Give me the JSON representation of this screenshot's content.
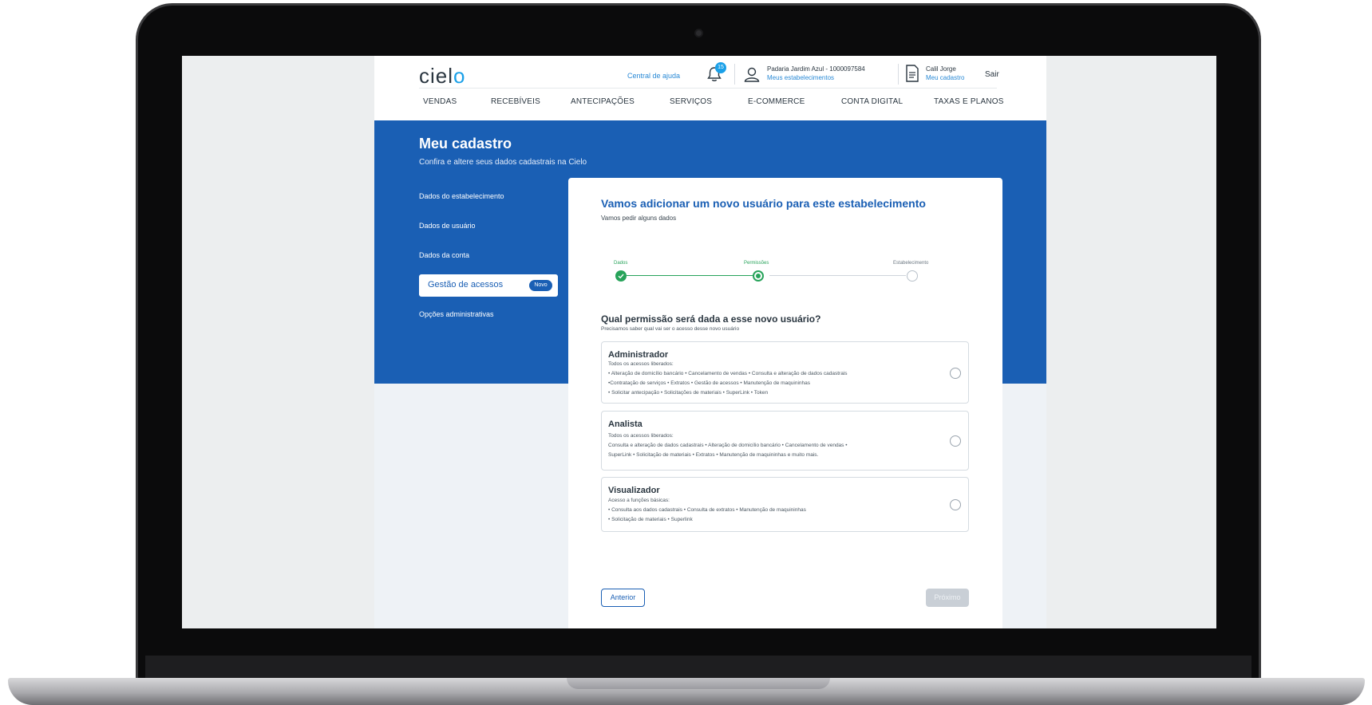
{
  "header": {
    "logo": "cielo",
    "help_link": "Central de ajuda",
    "notification_count": "15",
    "establishment_name": "Padaria Jardim Azul - 1000097584",
    "establishments_link": "Meus estabelecimentos",
    "user_name": "Calil Jorge",
    "profile_link": "Meu cadastro",
    "logout": "Sair"
  },
  "nav": [
    "VENDAS",
    "RECEBÍVEIS",
    "ANTECIPAÇÕES",
    "SERVIÇOS",
    "E-COMMERCE",
    "CONTA DIGITAL",
    "TAXAS E PLANOS"
  ],
  "hero": {
    "title": "Meu cadastro",
    "subtitle": "Confira e altere seus dados cadastrais na Cielo"
  },
  "sidebar": {
    "items": [
      {
        "label": "Dados do estabelecimento"
      },
      {
        "label": "Dados de usuário"
      },
      {
        "label": "Dados da conta"
      },
      {
        "label": "Gestão de acessos",
        "badge": "Novo",
        "active": true
      },
      {
        "label": "Opções administrativas"
      }
    ]
  },
  "card": {
    "title": "Vamos adicionar um novo usuário para este estabelecimento",
    "subtitle": "Vamos pedir alguns dados",
    "steps": [
      {
        "label": "Dados",
        "state": "done"
      },
      {
        "label": "Permissões",
        "state": "current"
      },
      {
        "label": "Estabelecimento",
        "state": "pending"
      }
    ],
    "question": "Qual permissão será dada a esse novo usuário?",
    "question_sub": "Precisamos saber qual vai ser o acesso desse novo usuário",
    "options": [
      {
        "title": "Administrador",
        "lines": [
          "Todos os acessos liberados:",
          "• Alteração de domicílio bancário • Cancelamento de vendas • Consulta e alteração de dados cadastrais",
          "•Contratação de serviços • Extratos • Gestão de acessos • Manutenção de maquininhas",
          "• Solicitar antecipação • Solicitações de materiais • SuperLink • Token"
        ]
      },
      {
        "title": "Analista",
        "lines": [
          "Todos os acessos liberados:",
          "Consulta e alteração de dados cadastrais • Alteração de domicílio bancário • Cancelamento de vendas •",
          "SuperLink • Solicitação de materiais • Extratos • Manutenção de maquininhas e muito mais."
        ]
      },
      {
        "title": "Visualizador",
        "lines": [
          "Acesso a funções básicas:",
          " •  Consulta aos dados cadastrais • Consulta de extratos •  Manutenção de maquininhas",
          "•  Solicitação de materiais • Superlink"
        ]
      }
    ],
    "prev_button": "Anterior",
    "next_button": "Próximo"
  },
  "colors": {
    "primary": "#1a5fb4",
    "step_done": "#27a35a",
    "logo_accent": "#1aa0e8"
  }
}
